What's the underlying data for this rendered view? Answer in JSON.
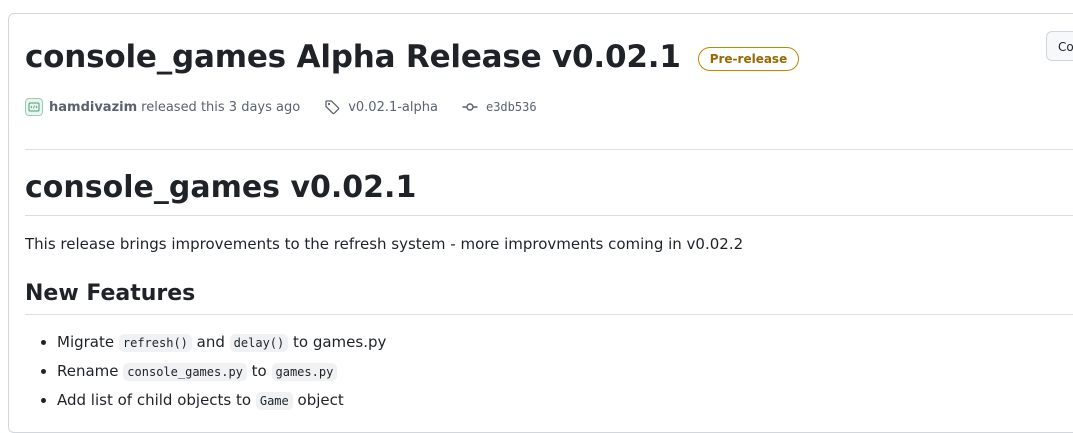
{
  "release": {
    "title": "console_games Alpha Release v0.02.1",
    "badge": "Pre-release",
    "compare_label": "Compare",
    "author": "hamdivazim",
    "released_text": "released this 3 days ago",
    "tag": "v0.02.1-alpha",
    "commit": "e3db536"
  },
  "body": {
    "heading": "console_games v0.02.1",
    "description": "This release brings improvements to the refresh system - more improvments coming in v0.02.2",
    "features_heading": "New Features",
    "features": [
      {
        "t1": "Migrate ",
        "c1": "refresh()",
        "t2": " and ",
        "c2": "delay()",
        "t3": " to games.py"
      },
      {
        "t1": "Rename ",
        "c1": "console_games.py",
        "t2": " to ",
        "c2": "games.py",
        "t3": ""
      },
      {
        "t1": "Add list of child objects to ",
        "c1": "Game",
        "t2": " object",
        "c2": "",
        "t3": ""
      }
    ]
  },
  "colors": {
    "badge_border": "#bf8700",
    "badge_text": "#9a6700",
    "code_bg": "#eff1f3",
    "divider": "#d8dee4"
  },
  "icons": {
    "avatar": "identicon-avatar",
    "tag": "tag-icon",
    "commit": "git-commit-icon"
  }
}
